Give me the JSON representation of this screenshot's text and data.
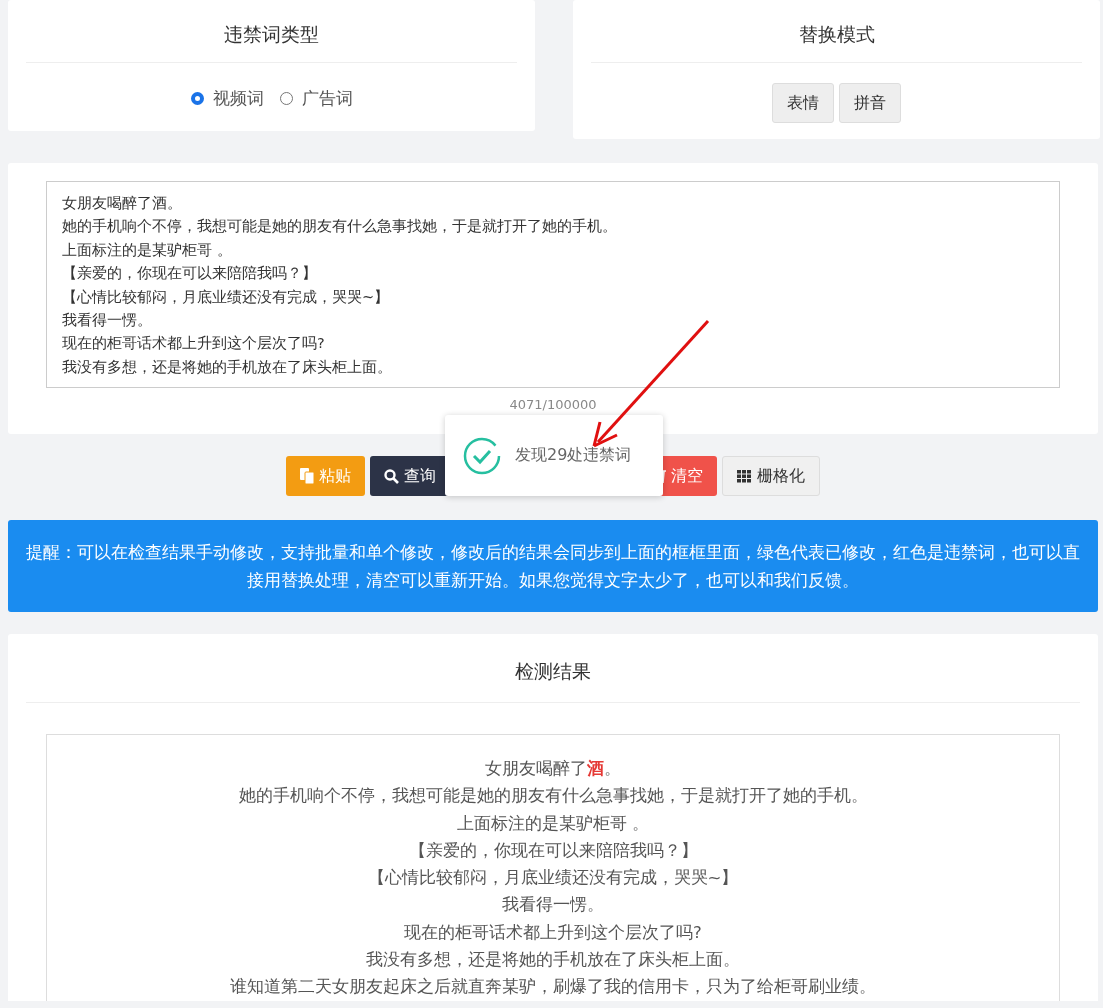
{
  "word_type": {
    "title": "违禁词类型",
    "options": [
      {
        "label": "视频词",
        "selected": true
      },
      {
        "label": "广告词",
        "selected": false
      }
    ]
  },
  "replace_mode": {
    "title": "替换模式",
    "buttons": [
      "表情",
      "拼音"
    ]
  },
  "editor": {
    "lines": [
      "女朋友喝醉了酒。",
      "她的手机响个不停，我想可能是她的朋友有什么急事找她，于是就打开了她的手机。",
      "上面标注的是某驴柜哥 。",
      "【亲爱的，你现在可以来陪陪我吗？】",
      "【心情比较郁闷，月底业绩还没有完成，哭哭~】",
      "我看得一愣。",
      "现在的柜哥话术都上升到这个层次了吗?",
      "我没有多想，还是将她的手机放在了床头柜上面。"
    ],
    "counter": "4071/100000"
  },
  "actions": [
    {
      "kind": "paste",
      "label": "粘贴"
    },
    {
      "kind": "query",
      "label": "查询"
    },
    {
      "kind": "clear",
      "label": "清空"
    },
    {
      "kind": "grid",
      "label": "栅格化"
    }
  ],
  "toast": {
    "message": "发现29处违禁词"
  },
  "notice": "提醒：可以在检查结果手动修改，支持批量和单个修改，修改后的结果会同步到上面的框框里面，绿色代表已修改，红色是违禁词，也可以直接用替换处理，清空可以重新开始。如果您觉得文字太少了，也可以和我们反馈。",
  "results": {
    "title": "检测结果",
    "lines": [
      [
        {
          "text": "女朋友喝醉了",
          "flagged": false
        },
        {
          "text": "酒",
          "flagged": true
        },
        {
          "text": "。",
          "flagged": false
        }
      ],
      [
        {
          "text": "她的手机响个不停，我想可能是她的朋友有什么急事找她，于是就打开了她的手机。",
          "flagged": false
        }
      ],
      [
        {
          "text": "上面标注的是某驴柜哥 。",
          "flagged": false
        }
      ],
      [
        {
          "text": "【亲爱的，你现在可以来陪陪我吗？】",
          "flagged": false
        }
      ],
      [
        {
          "text": "【心情比较郁闷，月底业绩还没有完成，哭哭~】",
          "flagged": false
        }
      ],
      [
        {
          "text": "我看得一愣。",
          "flagged": false
        }
      ],
      [
        {
          "text": "现在的柜哥话术都上升到这个层次了吗?",
          "flagged": false
        }
      ],
      [
        {
          "text": "我没有多想，还是将她的手机放在了床头柜上面。",
          "flagged": false
        }
      ],
      [
        {
          "text": "谁知道第二天女朋友起床之后就直奔某驴，刷爆了我的信用卡，只为了给柜哥刷业绩。",
          "flagged": false
        }
      ]
    ]
  }
}
